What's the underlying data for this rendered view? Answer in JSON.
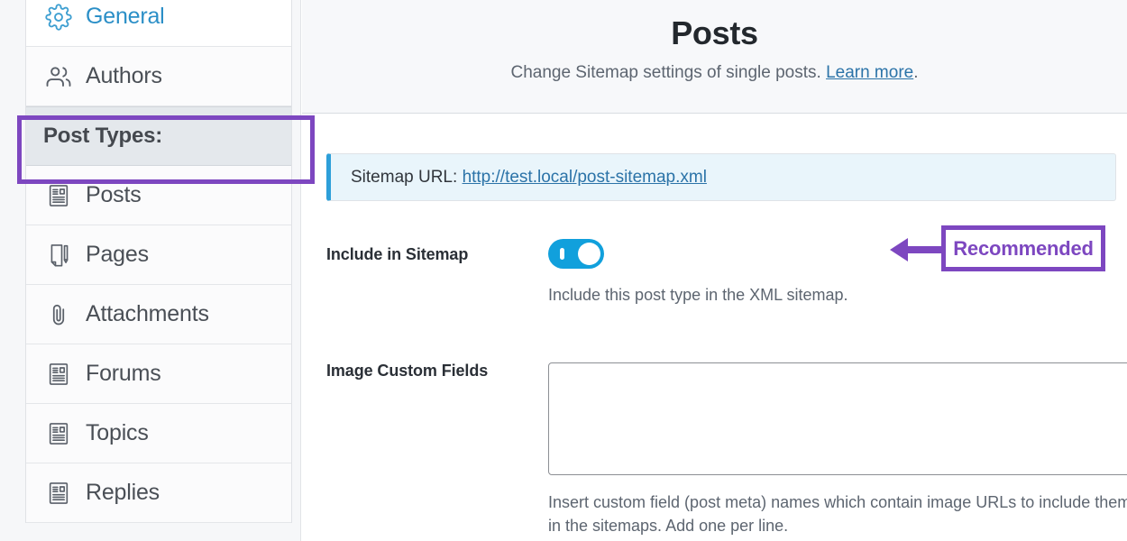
{
  "sidebar": {
    "items": [
      {
        "label": "General",
        "icon": "gear-icon",
        "state": "link",
        "bg": "white"
      },
      {
        "label": "Authors",
        "icon": "users-icon",
        "state": "normal",
        "bg": "light"
      },
      {
        "label": "Post Types:",
        "icon": "none",
        "state": "active",
        "bg": "active"
      },
      {
        "label": "Posts",
        "icon": "document-icon",
        "state": "normal",
        "bg": "light"
      },
      {
        "label": "Pages",
        "icon": "page-pencil-icon",
        "state": "normal",
        "bg": "light"
      },
      {
        "label": "Attachments",
        "icon": "paperclip-icon",
        "state": "normal",
        "bg": "light"
      },
      {
        "label": "Forums",
        "icon": "document-icon",
        "state": "normal",
        "bg": "light"
      },
      {
        "label": "Topics",
        "icon": "document-icon",
        "state": "normal",
        "bg": "light"
      },
      {
        "label": "Replies",
        "icon": "document-icon",
        "state": "normal",
        "bg": "light"
      }
    ],
    "highlight_target": "Post Types:"
  },
  "header": {
    "title": "Posts",
    "description_before": "Change Sitemap settings of single posts.",
    "learn_more_label": "Learn more",
    "description_after": "."
  },
  "notice": {
    "label": "Sitemap URL:",
    "url_text": "http://test.local/post-sitemap.xml"
  },
  "include_in_sitemap": {
    "label": "Include in Sitemap",
    "toggle_state": "on",
    "help": "Include this post type in the XML sitemap."
  },
  "image_custom_fields": {
    "label": "Image Custom Fields",
    "value": "",
    "placeholder": "",
    "help": "Insert custom field (post meta) names which contain image URLs to include them in the sitemaps. Add one per line."
  },
  "annotation": {
    "recommended_label": "Recommended",
    "arrow_direction": "left"
  },
  "colors": {
    "annotation_purple": "#7d47c0",
    "toggle_on_blue": "#11a0dc",
    "link_blue": "#2b73a8",
    "accent_blue": "#2b8fc7",
    "notice_bg": "#e9f5fb",
    "notice_border": "#2d9fd9"
  }
}
